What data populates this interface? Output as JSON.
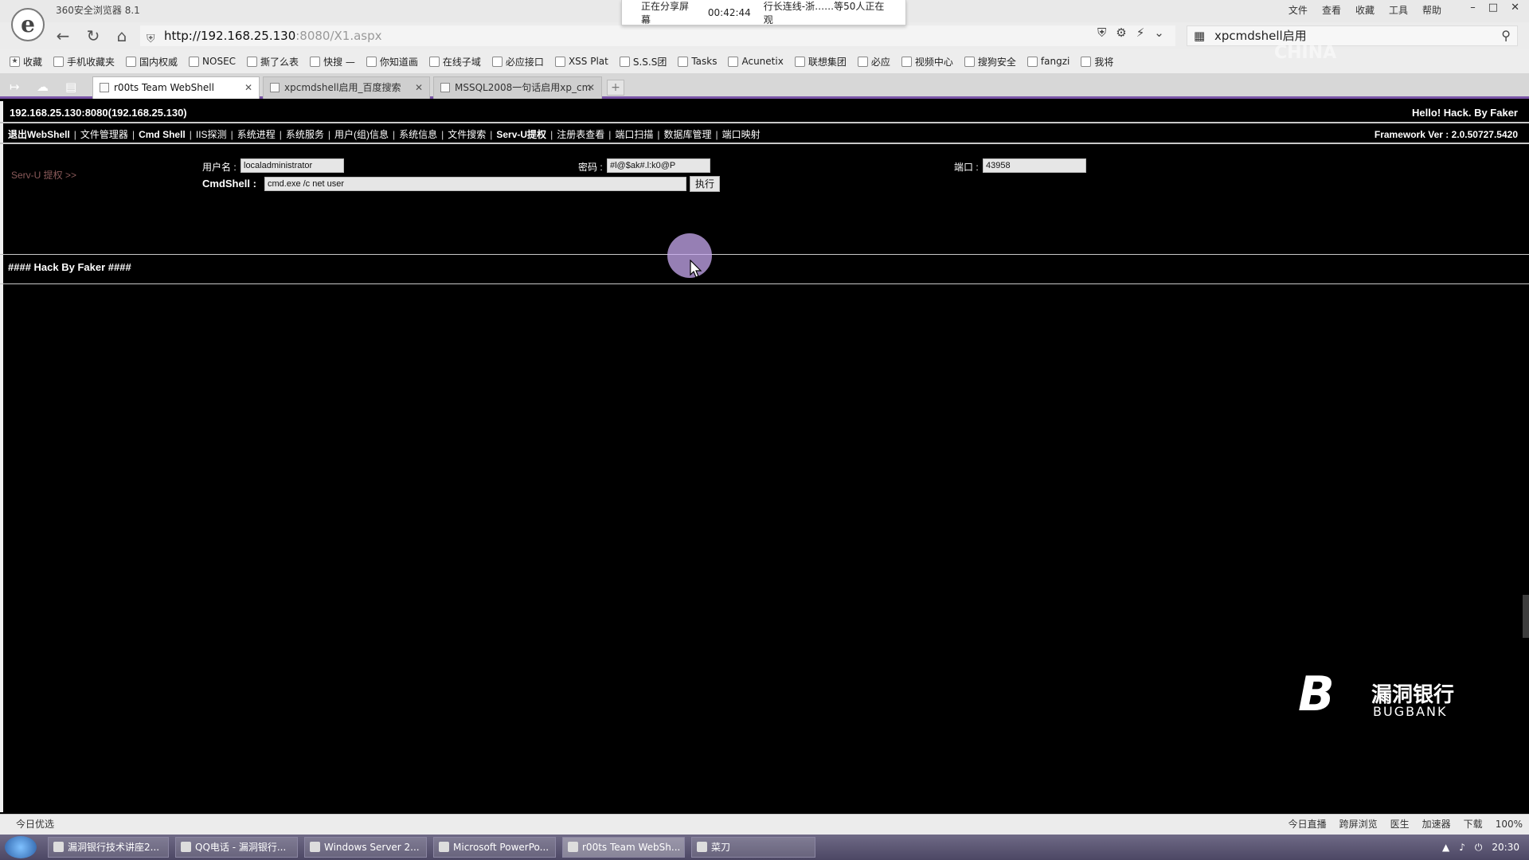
{
  "browser": {
    "app_title": "360安全浏览器 8.1",
    "title_menu": [
      "文件",
      "查看",
      "收藏",
      "工具",
      "帮助"
    ],
    "share_banner": {
      "status": "正在分享屏幕",
      "elapsed": "00:42:44",
      "viewers": "行长连线-浙……等50人正在观"
    },
    "url_host": "http://192.168.25.130",
    "url_rest": ":8080/X1.aspx",
    "search_text": "xpcmdshell启用",
    "bookmarks": [
      "收藏",
      "手机收藏夹",
      "国内权威",
      "NOSEC",
      "撕了么表",
      "快搜 —",
      "你知道画",
      "在线子域",
      "必应接口",
      "XSS Plat",
      "S.S.S团",
      "Tasks",
      "Acunetix",
      "联想集团",
      "必应",
      "视频中心",
      "搜狗安全",
      "fangzi",
      "我将"
    ],
    "tabs": [
      {
        "label": "r00ts Team WebShell"
      },
      {
        "label": "xpcmdshell启用_百度搜索"
      },
      {
        "label": "MSSQL2008一句话启用xp_cm"
      }
    ]
  },
  "webshell": {
    "host_info": "192.168.25.130:8080(192.168.25.130)",
    "greeting": "Hello! Hack. By Faker",
    "menu": [
      "退出WebShell",
      "文件管理器",
      "Cmd Shell",
      "IIS探测",
      "系统进程",
      "系统服务",
      "用户(组)信息",
      "系统信息",
      "文件搜索",
      "Serv-U提权",
      "注册表查看",
      "端口扫描",
      "数据库管理",
      "端口映射"
    ],
    "framework": "Framework Ver : 2.0.50727.5420",
    "section_title": "Serv-U 提权 >>",
    "form": {
      "username_label": "用户名 :",
      "username_value": "localadministrator",
      "password_label": "密码 :",
      "password_value": "#l@$ak#.l:k0@P",
      "port_label": "端口 :",
      "port_value": "43958",
      "cmd_label": "CmdShell :",
      "cmd_value": "cmd.exe /c net user",
      "exec_label": "执行"
    },
    "footer": "#### Hack By Faker ####"
  },
  "overlay": {
    "bugbank_cn": "漏洞银行",
    "bugbank_en": "BUGBANK"
  },
  "status_bar": {
    "left": "今日优选",
    "right": [
      "今日直播",
      "跨屏浏览",
      "医生",
      "加速器",
      "下载",
      "100%"
    ]
  },
  "taskbar": {
    "tasks": [
      "漏洞银行技术讲座2...",
      "QQ电话 - 漏洞银行...",
      "Windows Server 2...",
      "Microsoft PowerPo...",
      "r00ts Team WebSh...",
      "菜刀"
    ],
    "clock": "20:30"
  },
  "colors": {
    "accent_purple": "#7a55a8",
    "page_bg": "#000000",
    "section_title": "#8a5a5a"
  }
}
